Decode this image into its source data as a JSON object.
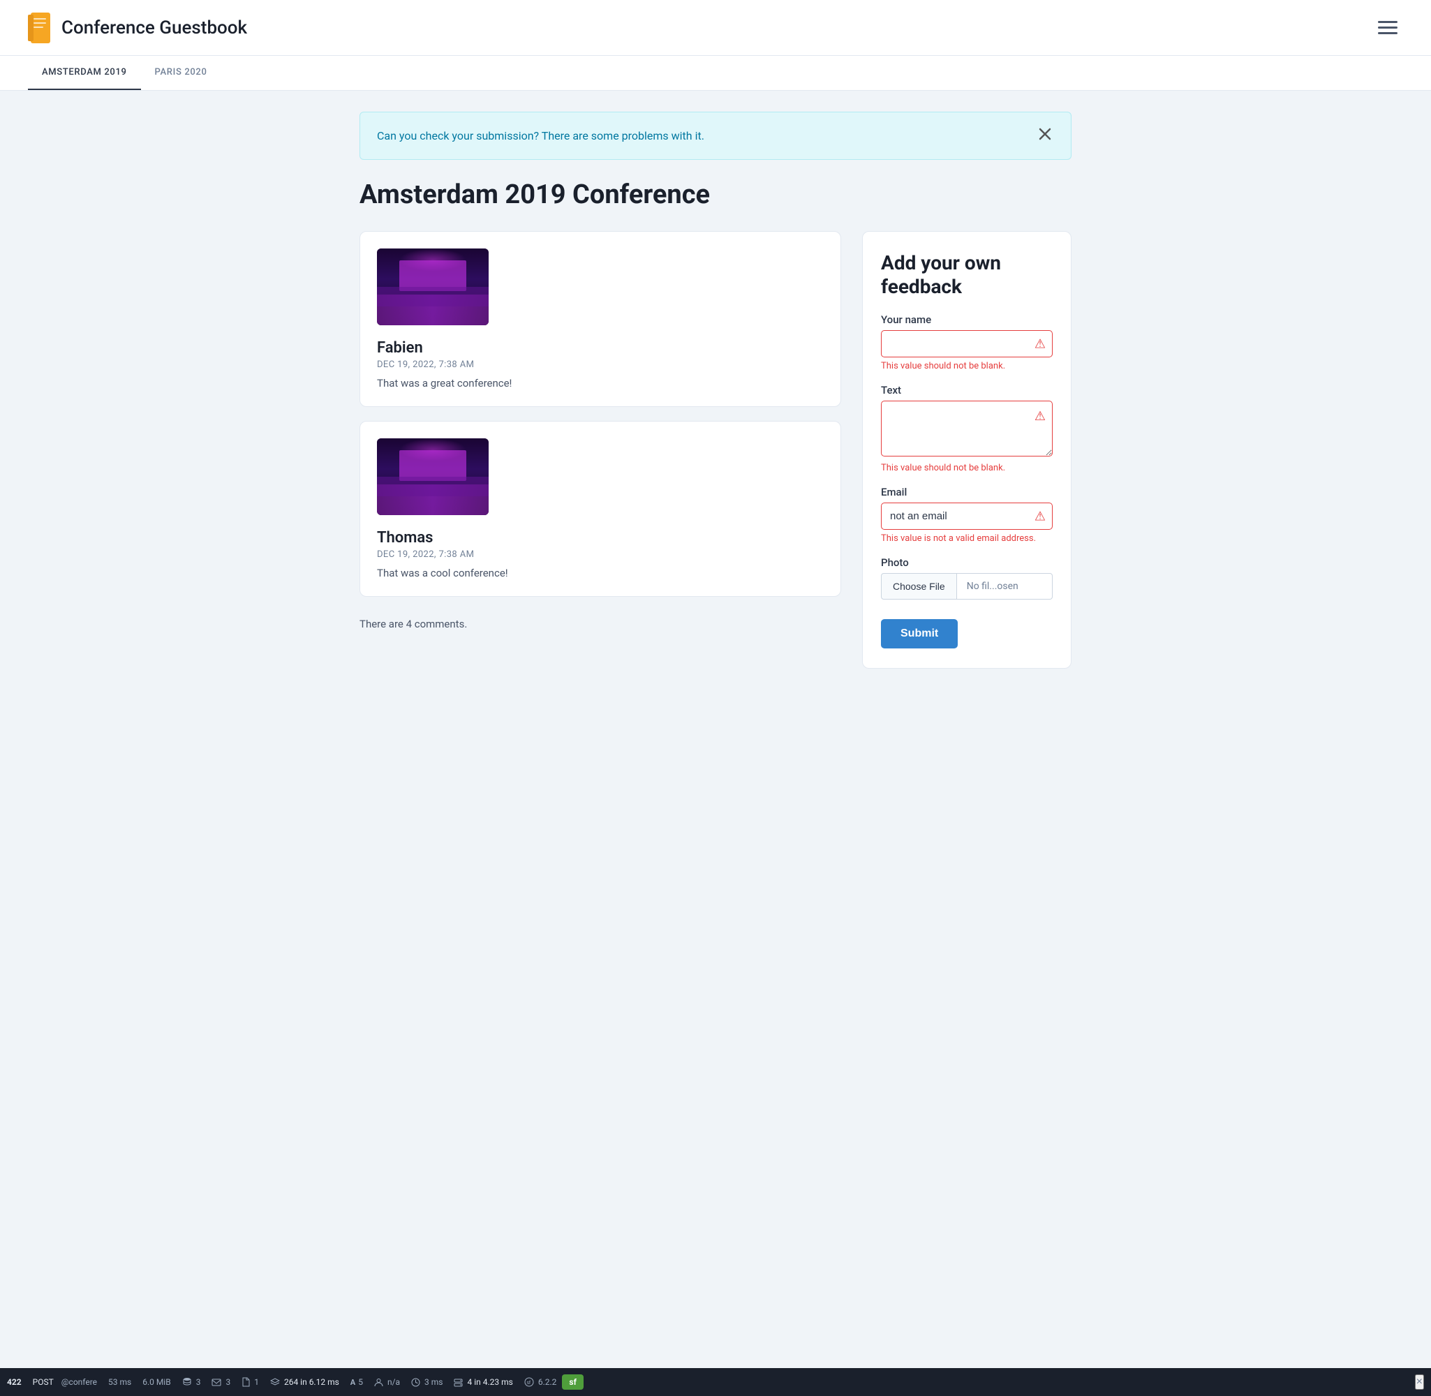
{
  "app": {
    "title": "Conference Guestbook",
    "logo_color": "#f6a623"
  },
  "nav": {
    "tabs": [
      {
        "label": "AMSTERDAM 2019",
        "active": true
      },
      {
        "label": "PARIS 2020",
        "active": false
      }
    ]
  },
  "alert": {
    "message": "Can you check your submission? There are some problems with it.",
    "close_label": "×"
  },
  "page": {
    "title": "Amsterdam 2019 Conference"
  },
  "comments": [
    {
      "author": "Fabien",
      "date": "DEC 19, 2022, 7:38 AM",
      "text": "That was a great conference!"
    },
    {
      "author": "Thomas",
      "date": "DEC 19, 2022, 7:38 AM",
      "text": "That was a cool conference!"
    }
  ],
  "comments_count_label": "There are 4 comments.",
  "feedback_form": {
    "title": "Add your own feedback",
    "name_label": "Your name",
    "name_placeholder": "",
    "name_error": "This value should not be blank.",
    "text_label": "Text",
    "text_placeholder": "",
    "text_error": "This value should not be blank.",
    "email_label": "Email",
    "email_value": "not an email",
    "email_error": "This value is not a valid email address.",
    "photo_label": "Photo",
    "choose_file_label": "Choose File",
    "file_name_display": "No fil...osen",
    "submit_label": "Submit"
  },
  "debug_bar": {
    "status_code": "422",
    "method": "POST",
    "route": "@confere",
    "time1": "53 ms",
    "memory": "6.0 MiB",
    "db_count": "3",
    "db_icon": "database",
    "mail_count": "3",
    "file_count": "1",
    "layers_count": "264",
    "layers_time": "6.12",
    "font_count": "5",
    "user": "n/a",
    "perf_time": "3 ms",
    "server_count": "4",
    "server_time": "4.23",
    "symfony_version": "6.2.2",
    "close_label": "×"
  }
}
